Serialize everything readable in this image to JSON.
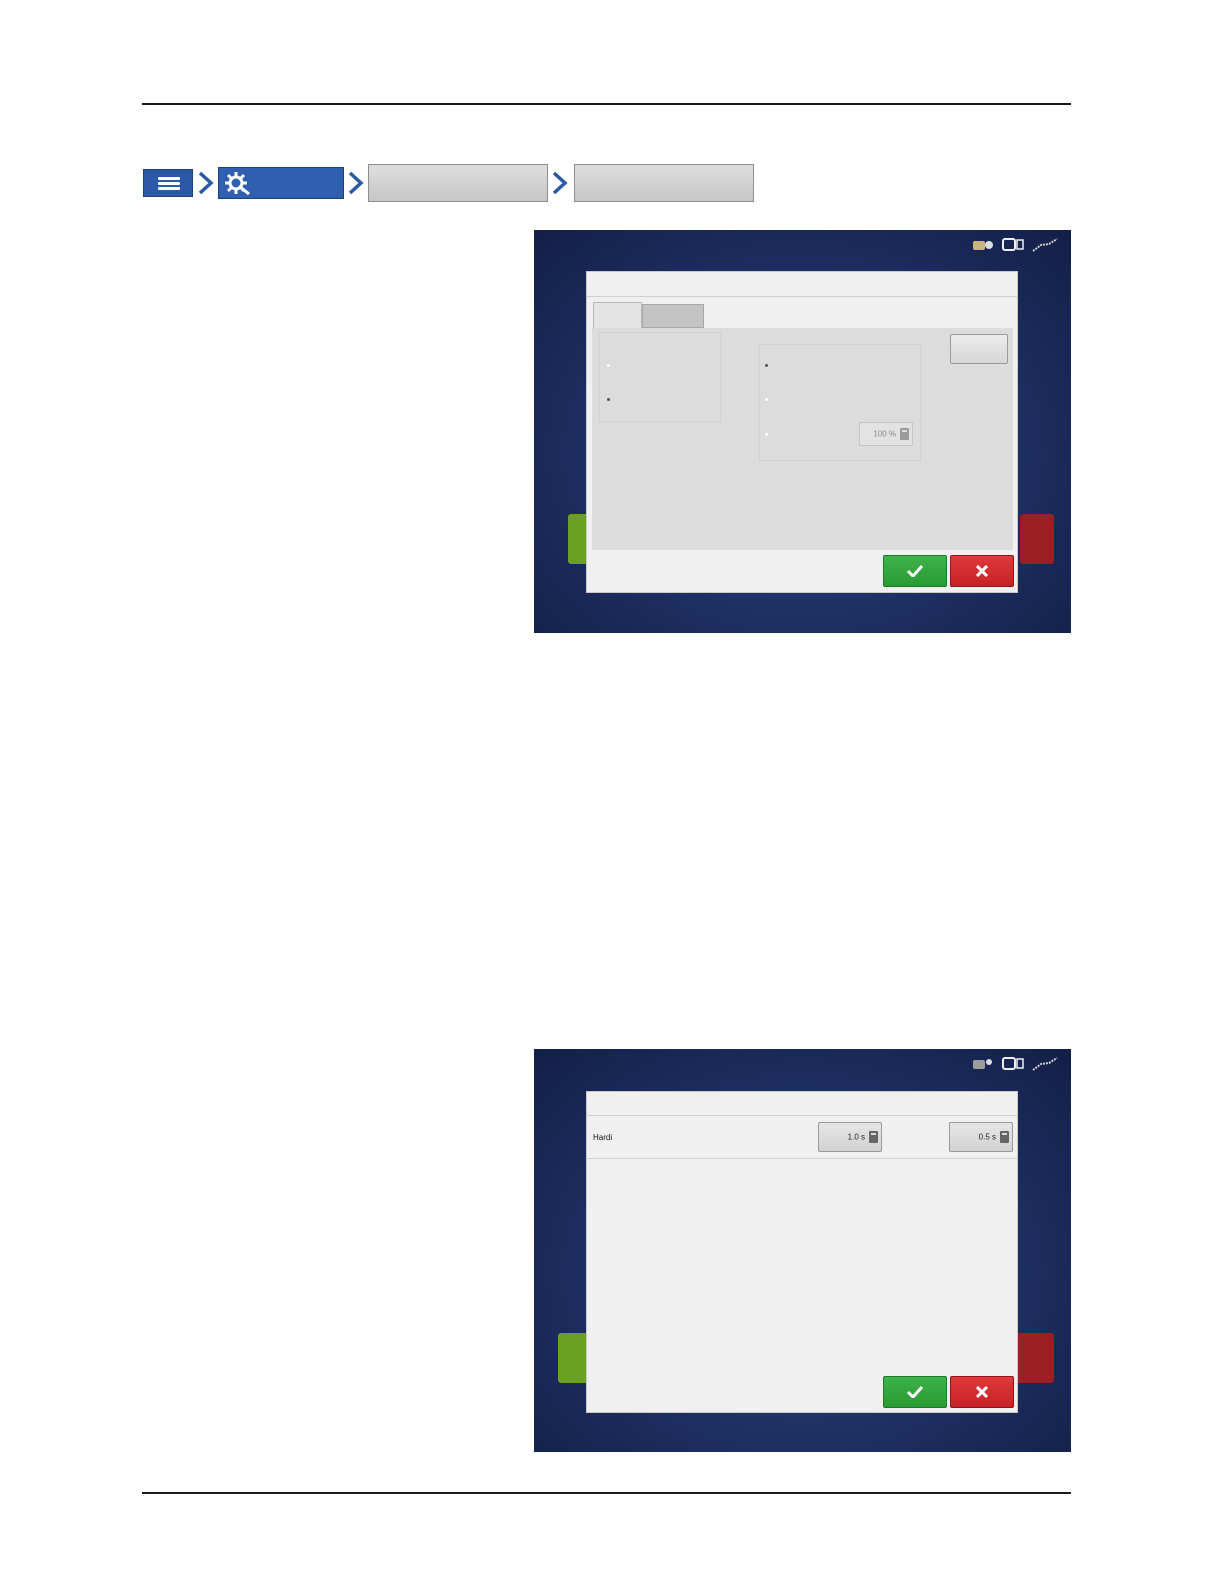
{
  "breadcrumb": {
    "menu_icon": "hamburger-menu-icon",
    "setup_icon": "gear-wrench-icon",
    "setup_label": "",
    "step3_label": "",
    "step4_label": ""
  },
  "screen1": {
    "status_icons": [
      "gps-icon",
      "display-icon",
      "signal-icon"
    ],
    "dialog_title": "",
    "tabs": [
      {
        "label": ""
      },
      {
        "label": ""
      }
    ],
    "field_value": "100 %",
    "ok_icon": "check-icon",
    "cancel_icon": "x-icon"
  },
  "screen2": {
    "status_icons": [
      "gps-icon",
      "display-icon",
      "signal-icon"
    ],
    "row_label": "Hardi",
    "value_1": "1.0 s",
    "value_2": "0.5 s",
    "ok_icon": "check-icon",
    "cancel_icon": "x-icon"
  },
  "colors": {
    "breadcrumb_blue": "#2f5fae",
    "ok_green": "#2a9a35",
    "cancel_red": "#c72226",
    "screen_bg": "#1e2f63"
  }
}
